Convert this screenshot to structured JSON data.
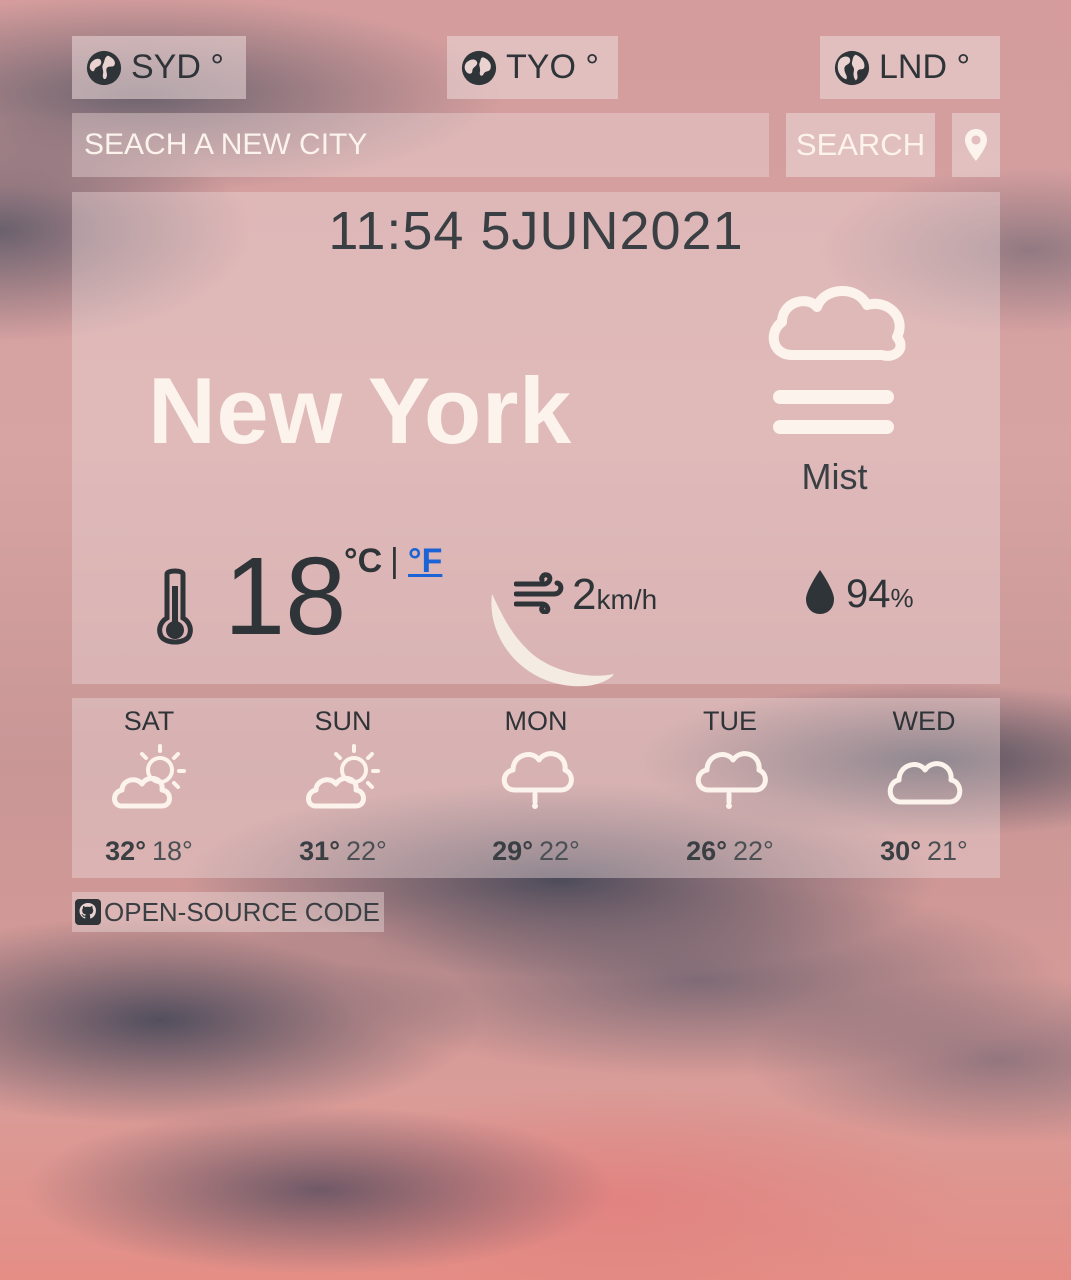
{
  "quick_cities": [
    {
      "label": "SYD °",
      "icon": "globe-icon"
    },
    {
      "label": "TYO °",
      "icon": "globe-icon"
    },
    {
      "label": "LND °",
      "icon": "globe-icon"
    }
  ],
  "search": {
    "placeholder": "SEACH A NEW CITY",
    "button_label": "SEARCH",
    "locate_icon": "location-pin-icon"
  },
  "current": {
    "datetime": "11:54 5JUN2021",
    "city": "New York",
    "condition": "Mist",
    "condition_icon": "mist-icon",
    "temperature": "18",
    "unit_c": "°C",
    "unit_separator": "|",
    "unit_f": "°F",
    "wind_value": "2",
    "wind_unit": "km/h",
    "humidity_value": "94",
    "humidity_unit": "%"
  },
  "forecast": [
    {
      "day": "SAT",
      "icon": "partly-sunny-icon",
      "high": "32°",
      "low": "18°"
    },
    {
      "day": "SUN",
      "icon": "partly-sunny-icon",
      "high": "31°",
      "low": "22°"
    },
    {
      "day": "MON",
      "icon": "rain-cloud-icon",
      "high": "29°",
      "low": "22°"
    },
    {
      "day": "TUE",
      "icon": "rain-cloud-icon",
      "high": "26°",
      "low": "22°"
    },
    {
      "day": "WED",
      "icon": "cloud-icon",
      "high": "30°",
      "low": "21°"
    }
  ],
  "footer": {
    "source_label": "OPEN-SOURCE CODE",
    "icon": "github-icon"
  },
  "colors": {
    "accent_link": "#1c63d6",
    "text_light": "#fbf3ec",
    "text_dark": "#2f3438"
  }
}
